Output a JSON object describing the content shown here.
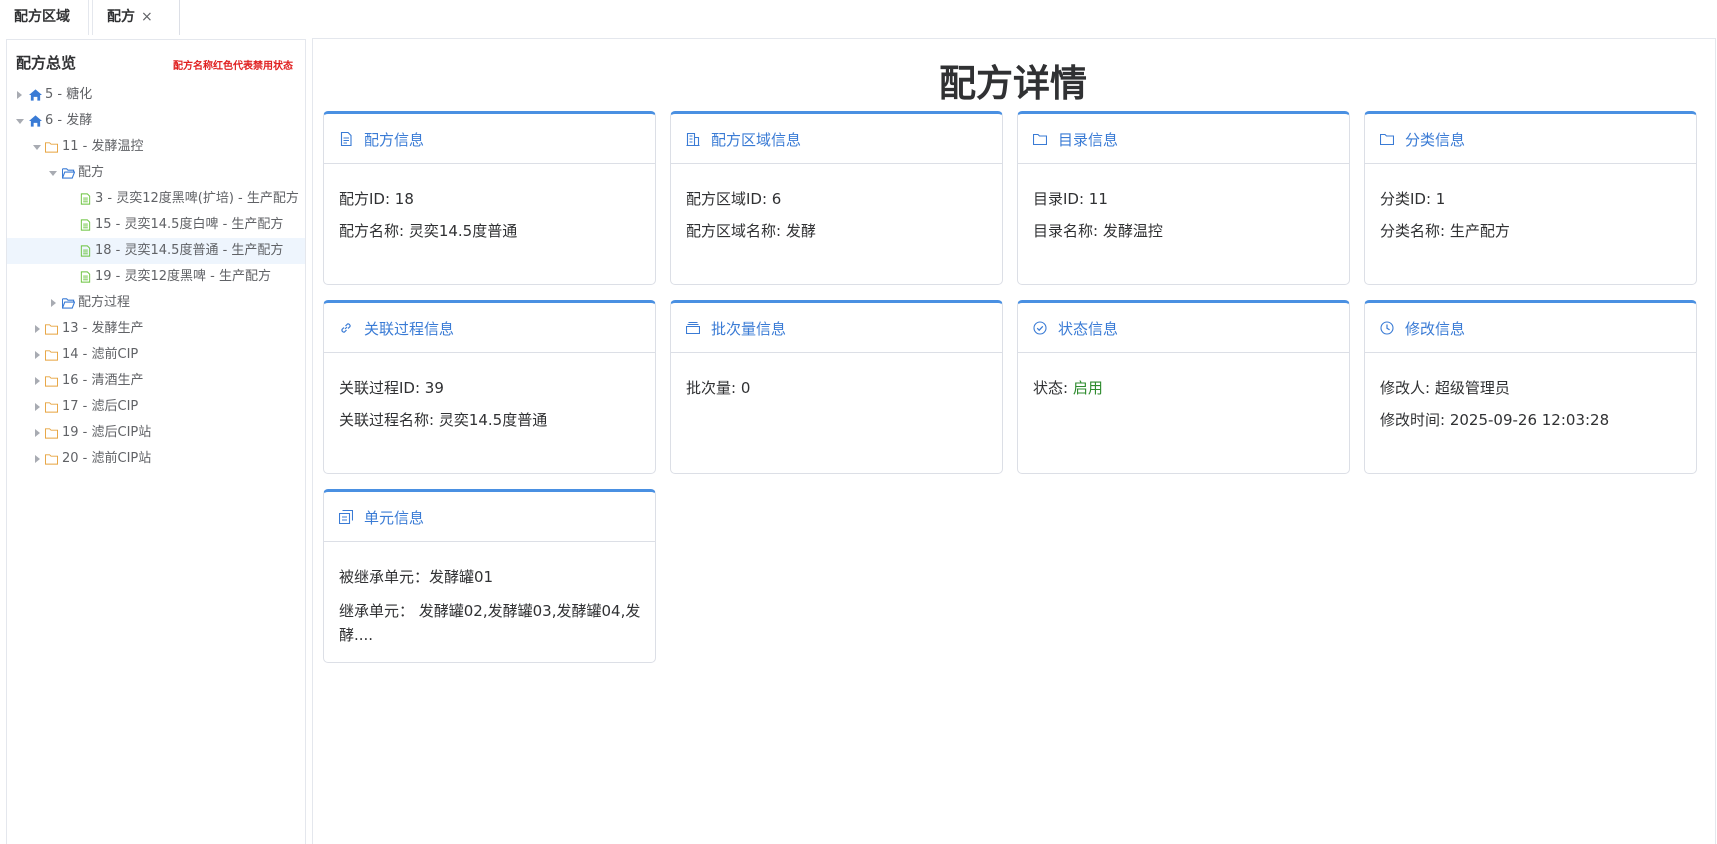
{
  "tabs": [
    {
      "label": "配方区域"
    },
    {
      "label": "配方",
      "close": "×"
    }
  ],
  "sidebar": {
    "title": "配方总览",
    "note": "配方名称红色代表禁用状态",
    "tree": [
      {
        "label": "5 - 糖化",
        "icon": "home-icon",
        "expanded": false
      },
      {
        "label": "6 - 发酵",
        "icon": "home-icon",
        "expanded": true
      },
      {
        "label": "11 - 发酵温控",
        "icon": "folder-icon",
        "expanded": true
      },
      {
        "label": "配方",
        "icon": "folder-open-icon",
        "expanded": true
      },
      {
        "label": "3 - 灵奕12度黑啤(扩培) - 生产配方",
        "icon": "document-icon"
      },
      {
        "label": "15 - 灵奕14.5度白啤 - 生产配方",
        "icon": "document-icon"
      },
      {
        "label": "18 - 灵奕14.5度普通 - 生产配方",
        "icon": "document-icon",
        "selected": true
      },
      {
        "label": "19 - 灵奕12度黑啤 - 生产配方",
        "icon": "document-icon"
      },
      {
        "label": "配方过程",
        "icon": "folder-open-icon",
        "expanded": false
      },
      {
        "label": "13 - 发酵生产",
        "icon": "folder-icon",
        "expanded": false
      },
      {
        "label": "14 - 滤前CIP",
        "icon": "folder-icon",
        "expanded": false
      },
      {
        "label": "16 - 清酒生产",
        "icon": "folder-icon",
        "expanded": false
      },
      {
        "label": "17 - 滤后CIP",
        "icon": "folder-icon",
        "expanded": false
      },
      {
        "label": "19 - 滤后CIP站",
        "icon": "folder-icon",
        "expanded": false
      },
      {
        "label": "20 - 滤前CIP站",
        "icon": "folder-icon",
        "expanded": false
      }
    ]
  },
  "main": {
    "title": "配方详情",
    "cards": {
      "recipe": {
        "title": "配方信息",
        "icon": "document-icon",
        "rows": [
          "配方ID: 18",
          "配方名称: 灵奕14.5度普通"
        ]
      },
      "area": {
        "title": "配方区域信息",
        "icon": "building-icon",
        "rows": [
          "配方区域ID: 6",
          "配方区域名称: 发酵"
        ]
      },
      "catalog": {
        "title": "目录信息",
        "icon": "folder-icon",
        "rows": [
          "目录ID: 11",
          "目录名称: 发酵温控"
        ]
      },
      "category": {
        "title": "分类信息",
        "icon": "folder-icon",
        "rows": [
          "分类ID: 1",
          "分类名称: 生产配方"
        ]
      },
      "process": {
        "title": "关联过程信息",
        "icon": "link-icon",
        "rows": [
          "关联过程ID: 39",
          "关联过程名称: 灵奕14.5度普通"
        ]
      },
      "batch": {
        "title": "批次量信息",
        "icon": "box-icon",
        "rows": [
          "批次量: 0"
        ]
      },
      "status": {
        "title": "状态信息",
        "icon": "check-circle-icon",
        "label": "状态: ",
        "value": "启用"
      },
      "modify": {
        "title": "修改信息",
        "icon": "clock-icon",
        "rows": [
          "修改人: 超级管理员",
          "修改时间: 2025-09-26 12:03:28"
        ]
      },
      "unit": {
        "title": "单元信息",
        "icon": "copy-icon",
        "rows": [
          "被继承单元：发酵罐01",
          "继承单元： 发酵罐02,发酵罐03,发酵罐04,发酵...."
        ]
      }
    }
  },
  "colors": {
    "accent": "#4a90e2",
    "title_blue": "#3a7bd5",
    "enabled": "#2e8b2e",
    "note_red": "#e02020",
    "folder": "#e6a23c",
    "document": "#67c23a"
  }
}
